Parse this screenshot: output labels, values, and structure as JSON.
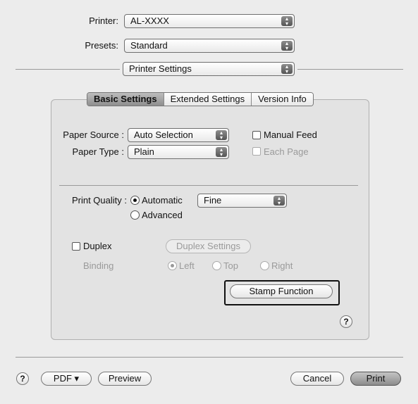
{
  "printer": {
    "label": "Printer:",
    "value": "AL-XXXX"
  },
  "presets": {
    "label": "Presets:",
    "value": "Standard"
  },
  "pane_selector": {
    "value": "Printer Settings"
  },
  "tabs": [
    {
      "label": "Basic Settings",
      "selected": true
    },
    {
      "label": "Extended Settings",
      "selected": false
    },
    {
      "label": "Version Info",
      "selected": false
    }
  ],
  "paper_source": {
    "label": "Paper Source :",
    "value": "Auto Selection"
  },
  "paper_type": {
    "label": "Paper Type :",
    "value": "Plain"
  },
  "manual_feed": {
    "label": "Manual Feed",
    "checked": false
  },
  "each_page": {
    "label": "Each Page",
    "checked": false,
    "enabled": false
  },
  "print_quality": {
    "label": "Print Quality :",
    "automatic_label": "Automatic",
    "advanced_label": "Advanced",
    "selected": "Automatic",
    "quality_value": "Fine"
  },
  "duplex": {
    "label": "Duplex",
    "checked": false,
    "settings_button": "Duplex Settings"
  },
  "binding": {
    "label": "Binding",
    "left": "Left",
    "top": "Top",
    "right": "Right",
    "selected": "Left"
  },
  "stamp_button": "Stamp Function",
  "help_glyph": "?",
  "bottom_bar": {
    "pdf_label": "PDF ▾",
    "preview_label": "Preview",
    "cancel_label": "Cancel",
    "print_label": "Print"
  },
  "icons": {
    "popup_arrows": "▴▾"
  },
  "colors": {
    "background": "#ececec",
    "group_box": "#e3e3e3",
    "disabled_text": "#9a9a9a"
  }
}
